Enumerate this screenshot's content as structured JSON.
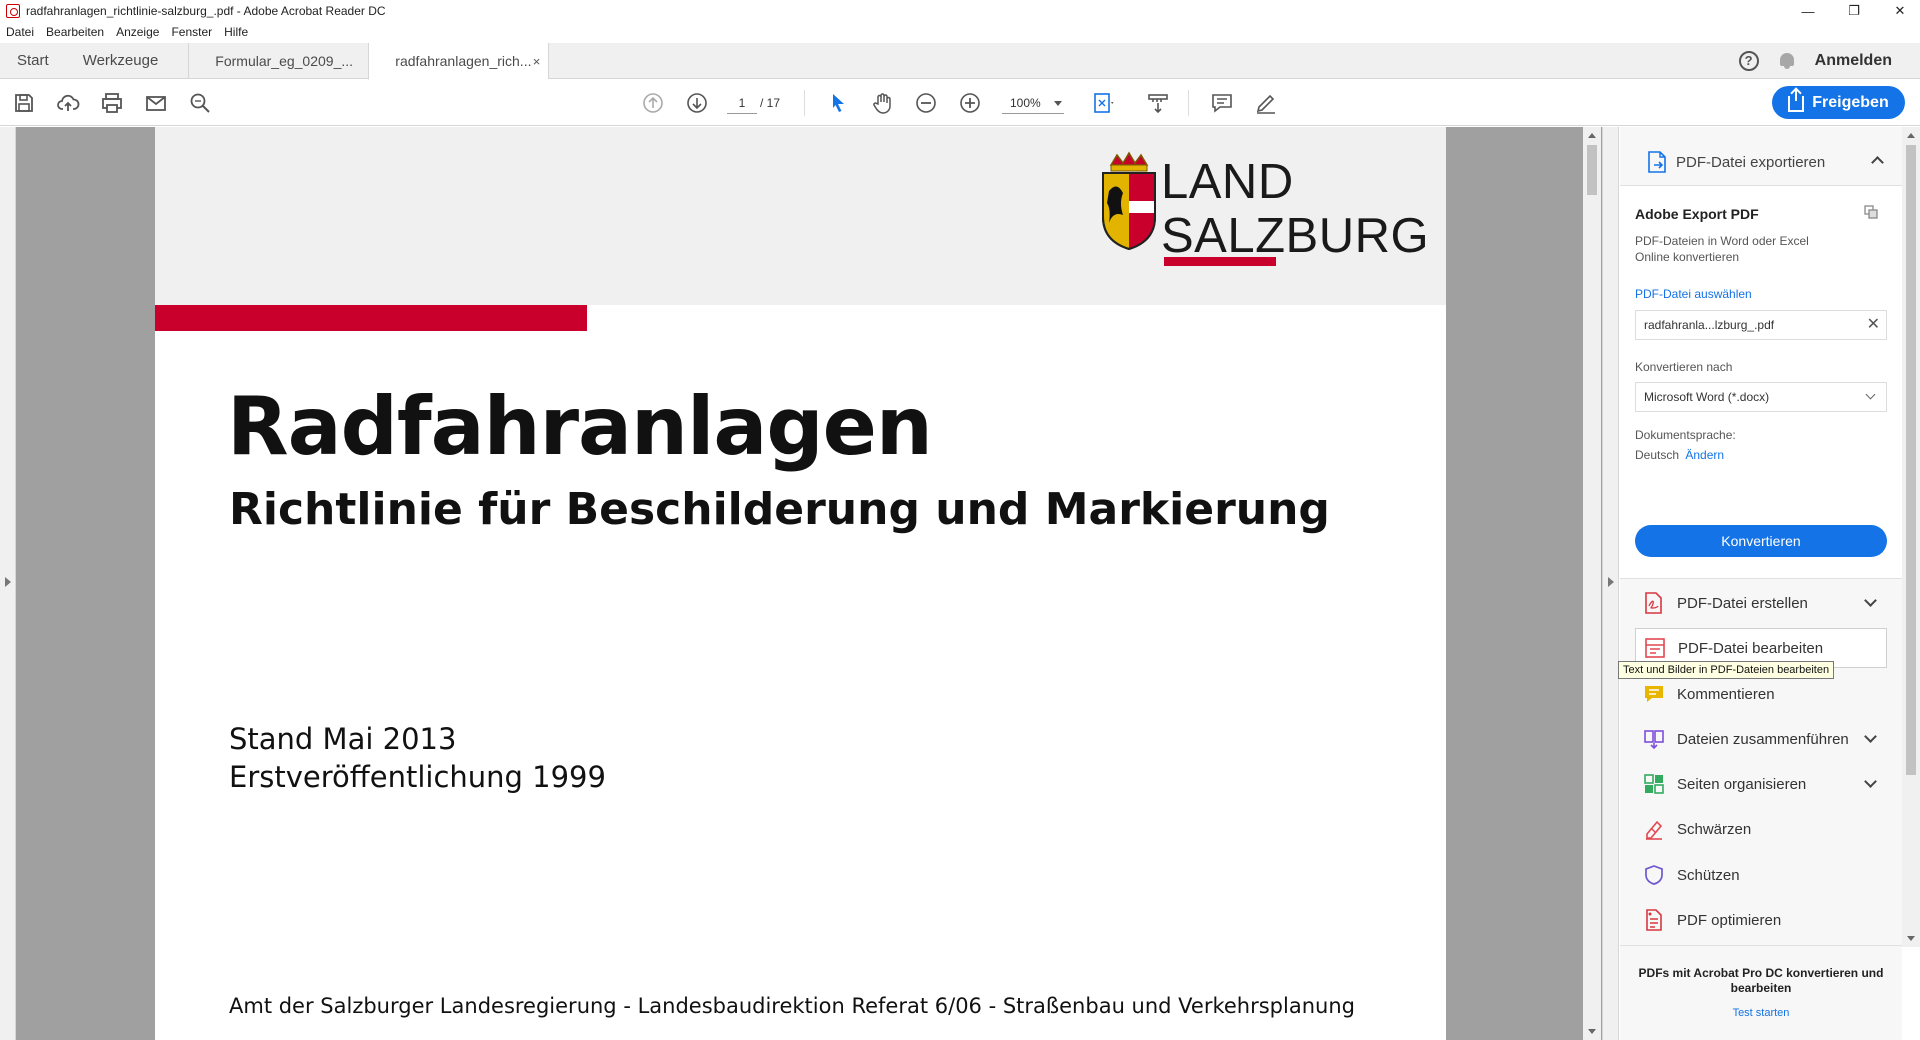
{
  "window": {
    "title": "radfahranlagen_richtlinie-salzburg_.pdf - Adobe Acrobat Reader DC",
    "minimize": "—",
    "maximize": "❐",
    "close": "✕"
  },
  "menu": [
    "Datei",
    "Bearbeiten",
    "Anzeige",
    "Fenster",
    "Hilfe"
  ],
  "tabs": {
    "home": "Start",
    "tools": "Werkzeuge",
    "docs": [
      {
        "label": "Formular_eg_0209_...",
        "active": false
      },
      {
        "label": "radfahranlagen_rich...",
        "active": true,
        "close": "×"
      }
    ]
  },
  "header_right": {
    "help": "?",
    "signin": "Anmelden"
  },
  "toolbar": {
    "page_current": "1",
    "page_total": "/ 17",
    "zoom": "100%",
    "share_label": "Freigeben"
  },
  "document": {
    "logo_text_line1": "LAND",
    "logo_text_line2": "SALZBURG",
    "title": "Radfahranlagen",
    "subtitle": "Richtlinie für Beschilderung und Markierung",
    "stand": "Stand Mai 2013",
    "first_pub": "Erstveröffentlichung 1999",
    "footer": "Amt der Salzburger Landesregierung - Landesbaudirektion Referat 6/06 - Straßenbau und Verkehrsplanung"
  },
  "panel": {
    "export_header": "PDF-Datei exportieren",
    "export_title": "Adobe Export PDF",
    "export_desc": "PDF-Dateien in Word oder Excel Online konvertieren",
    "select_file_link": "PDF-Datei auswählen",
    "selected_file": "radfahranla...lzburg_.pdf",
    "convert_to_label": "Konvertieren nach",
    "convert_to_value": "Microsoft Word (*.docx)",
    "doc_lang_label": "Dokumentsprache:",
    "doc_lang_value": "Deutsch",
    "doc_lang_change": "Ändern",
    "convert_button": "Konvertieren",
    "tools": [
      {
        "label": "PDF-Datei erstellen",
        "icon": "create-pdf-icon",
        "color": "#d7373f",
        "expandable": true
      },
      {
        "label": "PDF-Datei bearbeiten",
        "icon": "edit-pdf-icon",
        "color": "#e34850",
        "expandable": false
      },
      {
        "label": "Kommentieren",
        "icon": "comment-icon",
        "color": "#e8b500",
        "expandable": false
      },
      {
        "label": "Dateien zusammenführen",
        "icon": "combine-files-icon",
        "color": "#7e4fd8",
        "expandable": true
      },
      {
        "label": "Seiten organisieren",
        "icon": "organize-pages-icon",
        "color": "#33ab5f",
        "expandable": true
      },
      {
        "label": "Schwärzen",
        "icon": "redact-icon",
        "color": "#e34850",
        "expandable": false
      },
      {
        "label": "Schützen",
        "icon": "protect-icon",
        "color": "#6e56cf",
        "expandable": false
      },
      {
        "label": "PDF optimieren",
        "icon": "optimize-pdf-icon",
        "color": "#d7373f",
        "expandable": false
      }
    ],
    "tooltip": "Text und Bilder in PDF-Dateien bearbeiten",
    "promo_text": "PDFs mit Acrobat Pro DC konvertieren und bearbeiten",
    "promo_link": "Test starten"
  },
  "colors": {
    "accent": "#1473e6",
    "salzburg_red": "#c8002b"
  }
}
